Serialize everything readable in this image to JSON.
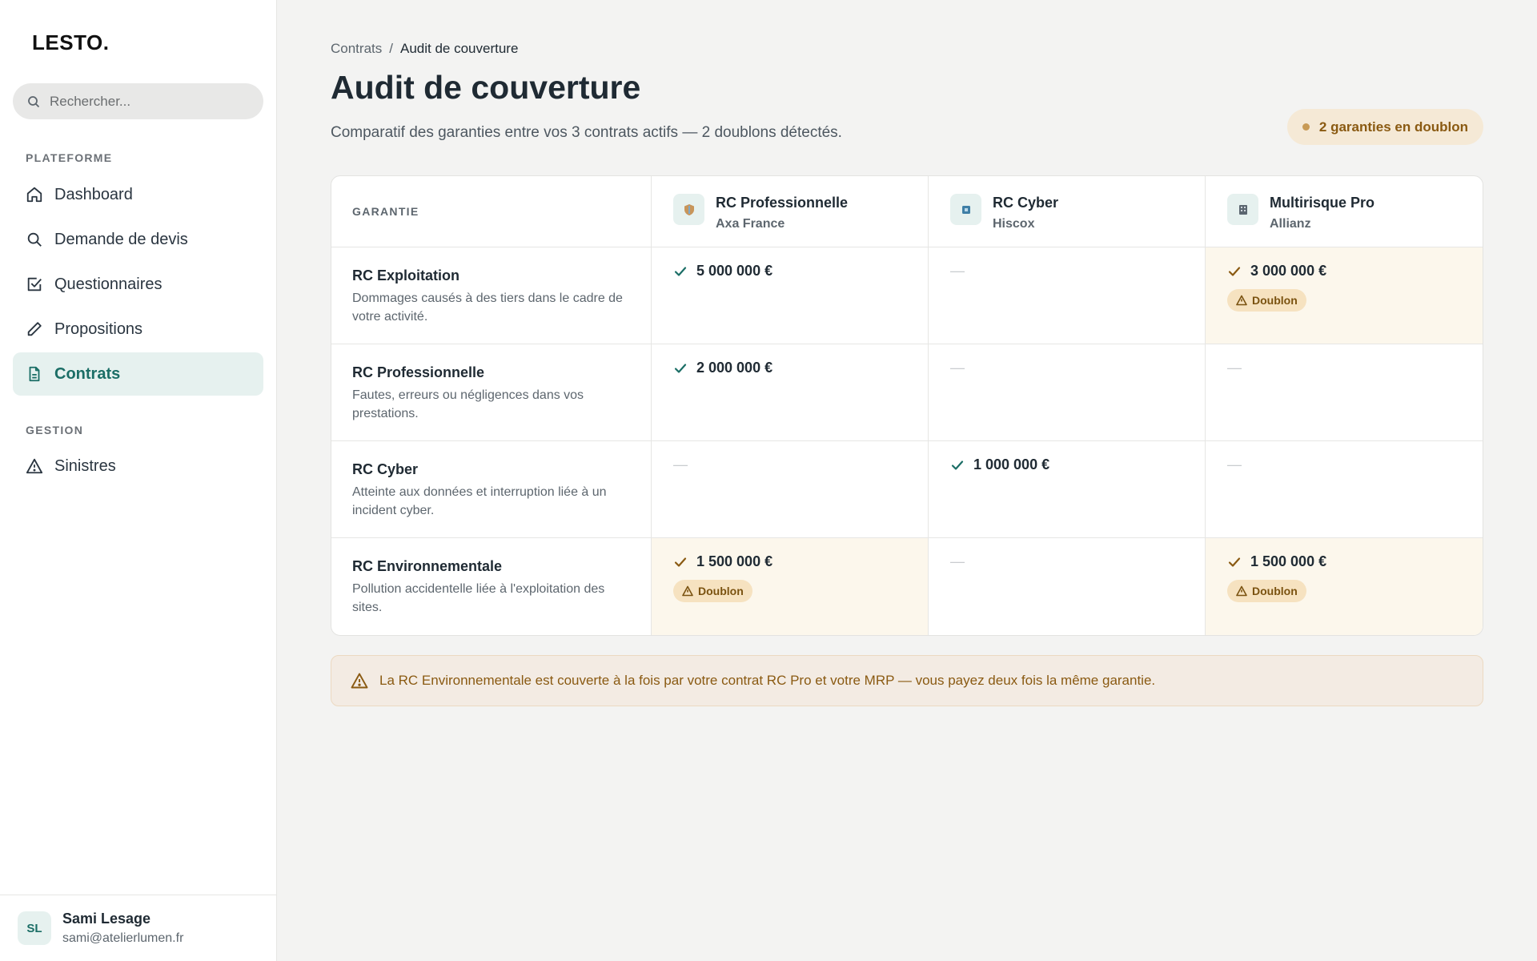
{
  "app": {
    "logo": "LESTO."
  },
  "search": {
    "placeholder": "Rechercher..."
  },
  "sidebar": {
    "section_platform": "PLATEFORME",
    "section_management": "GESTION",
    "items": [
      {
        "label": "Dashboard",
        "icon": "home-icon"
      },
      {
        "label": "Demande de devis",
        "icon": "search-icon"
      },
      {
        "label": "Questionnaires",
        "icon": "checkbox-icon"
      },
      {
        "label": "Propositions",
        "icon": "pencil-icon"
      },
      {
        "label": "Contrats",
        "icon": "document-icon",
        "active": true
      }
    ],
    "management_items": [
      {
        "label": "Sinistres",
        "icon": "warning-icon"
      }
    ]
  },
  "user": {
    "initials": "SL",
    "name": "Sami Lesage",
    "email": "sami@atelierlumen.fr"
  },
  "breadcrumb": {
    "parent": "Contrats",
    "separator": "/",
    "current": "Audit de couverture"
  },
  "page": {
    "title": "Audit de couverture",
    "subtitle": "Comparatif des garanties entre vos 3 contrats actifs — 2 doublons détectés.",
    "duplicates_badge": "2 garanties en doublon"
  },
  "table": {
    "header_label": "GARANTIE",
    "contracts": [
      {
        "name": "RC Professionnelle",
        "insurer": "Axa France"
      },
      {
        "name": "RC Cyber",
        "insurer": "Hiscox"
      },
      {
        "name": "Multirisque Pro",
        "insurer": "Allianz"
      }
    ],
    "dup_label": "Doublon",
    "dash": "—",
    "rows": [
      {
        "title": "RC Exploitation",
        "desc": "Dommages causés à des tiers dans le cadre de votre activité.",
        "cells": [
          "5 000 000 €",
          "",
          "3 000 000 €"
        ],
        "duplicates": [
          false,
          false,
          true
        ]
      },
      {
        "title": "RC Professionnelle",
        "desc": "Fautes, erreurs ou négligences dans vos prestations.",
        "cells": [
          "2 000 000 €",
          "",
          ""
        ],
        "duplicates": [
          false,
          false,
          false
        ]
      },
      {
        "title": "RC Cyber",
        "desc": "Atteinte aux données et interruption liée à un incident cyber.",
        "cells": [
          "",
          "1 000 000 €",
          ""
        ],
        "duplicates": [
          false,
          false,
          false
        ]
      },
      {
        "title": "RC Environnementale",
        "desc": "Pollution accidentelle liée à l'exploitation des sites.",
        "cells": [
          "1 500 000 €",
          "",
          "1 500 000 €"
        ],
        "duplicates": [
          true,
          false,
          true
        ]
      }
    ]
  },
  "alert": {
    "text": "La RC Environnementale est couverte à la fois par votre contrat RC Pro et votre MRP — vous payez deux fois la même garantie."
  },
  "colors": {
    "accent": "#1b6e66",
    "warning": "#8a5a12",
    "duplicate_bg": "#fcf7ec"
  }
}
